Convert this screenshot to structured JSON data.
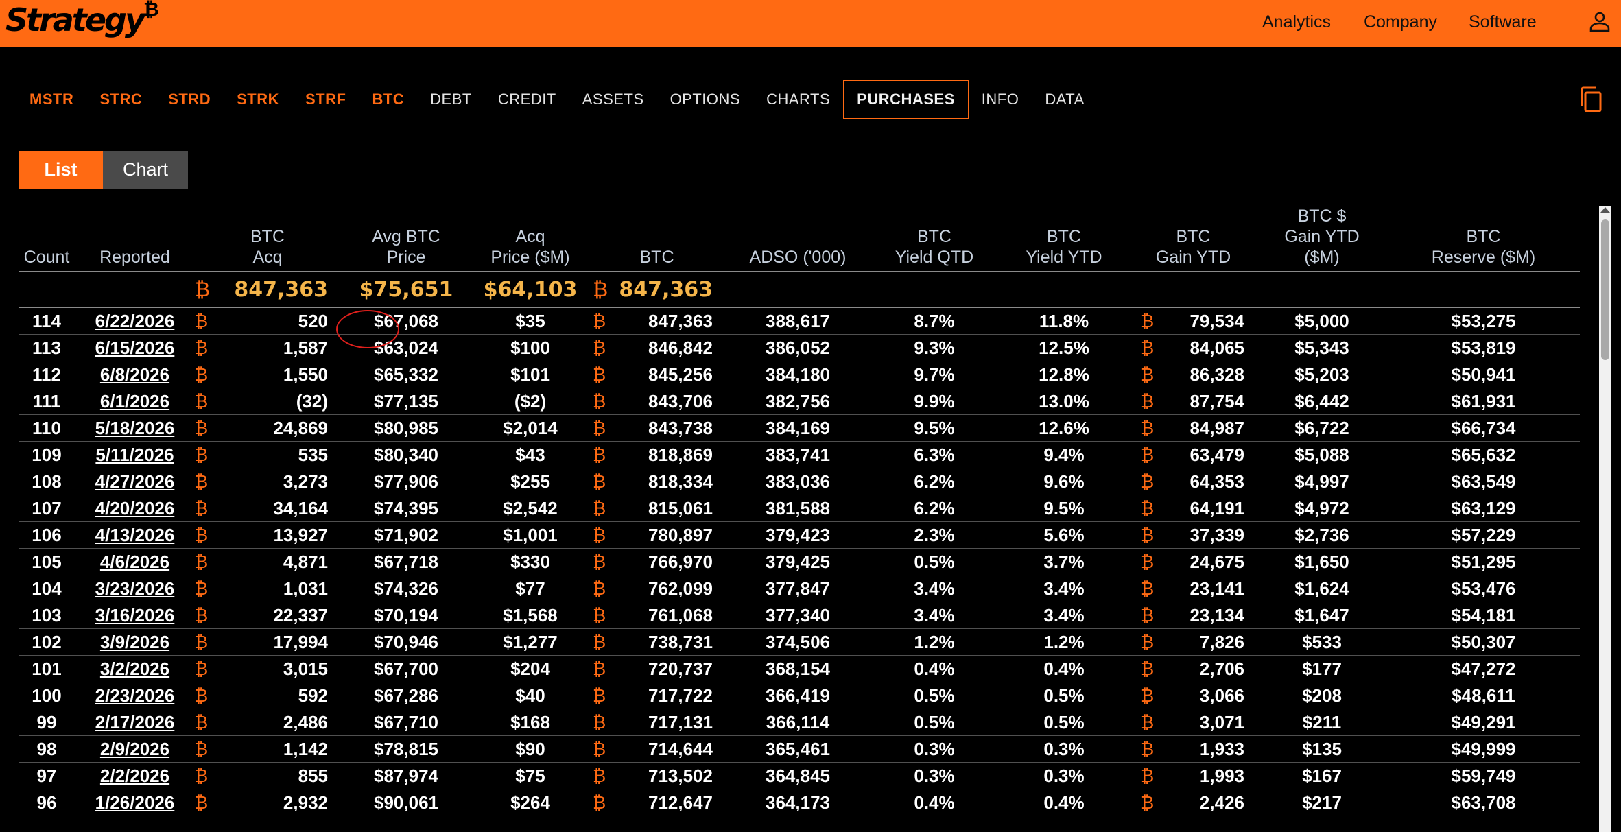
{
  "brand": {
    "name": "Strategy",
    "mark": "₿"
  },
  "top_nav": [
    "Analytics",
    "Company",
    "Software"
  ],
  "ticker_nav": [
    {
      "label": "MSTR",
      "style": "orange"
    },
    {
      "label": "STRC",
      "style": "orange"
    },
    {
      "label": "STRD",
      "style": "orange"
    },
    {
      "label": "STRK",
      "style": "orange"
    },
    {
      "label": "STRF",
      "style": "orange"
    },
    {
      "label": "BTC",
      "style": "orange"
    },
    {
      "label": "DEBT",
      "style": "plain"
    },
    {
      "label": "CREDIT",
      "style": "plain"
    },
    {
      "label": "ASSETS",
      "style": "plain"
    },
    {
      "label": "OPTIONS",
      "style": "plain"
    },
    {
      "label": "CHARTS",
      "style": "plain"
    },
    {
      "label": "PURCHASES",
      "style": "active"
    },
    {
      "label": "INFO",
      "style": "plain"
    },
    {
      "label": "DATA",
      "style": "plain"
    }
  ],
  "toggle": {
    "list": "List",
    "chart": "Chart"
  },
  "btc_symbol": "₿",
  "columns": [
    [
      "Count"
    ],
    [
      "Reported"
    ],
    [
      "BTC",
      "Acq"
    ],
    [
      "Avg BTC",
      "Price"
    ],
    [
      "Acq",
      "Price ($M)"
    ],
    [
      "BTC"
    ],
    [
      "ADSO ('000)"
    ],
    [
      "BTC",
      "Yield QTD"
    ],
    [
      "BTC",
      "Yield YTD"
    ],
    [
      "BTC",
      "Gain YTD"
    ],
    [
      "BTC $",
      "Gain YTD",
      "($M)"
    ],
    [
      "BTC",
      "Reserve ($M)"
    ]
  ],
  "summary": {
    "btc_acq": "847,363",
    "avg_price": "$75,651",
    "acq_price": "$64,103",
    "btc": "847,363"
  },
  "rows": [
    [
      "114",
      "6/22/2026",
      "520",
      "$67,068",
      "$35",
      "847,363",
      "388,617",
      "8.7%",
      "11.8%",
      "79,534",
      "$5,000",
      "$53,275"
    ],
    [
      "113",
      "6/15/2026",
      "1,587",
      "$63,024",
      "$100",
      "846,842",
      "386,052",
      "9.3%",
      "12.5%",
      "84,065",
      "$5,343",
      "$53,819"
    ],
    [
      "112",
      "6/8/2026",
      "1,550",
      "$65,332",
      "$101",
      "845,256",
      "384,180",
      "9.7%",
      "12.8%",
      "86,328",
      "$5,203",
      "$50,941"
    ],
    [
      "111",
      "6/1/2026",
      "(32)",
      "$77,135",
      "($2)",
      "843,706",
      "382,756",
      "9.9%",
      "13.0%",
      "87,754",
      "$6,442",
      "$61,931"
    ],
    [
      "110",
      "5/18/2026",
      "24,869",
      "$80,985",
      "$2,014",
      "843,738",
      "384,169",
      "9.5%",
      "12.6%",
      "84,987",
      "$6,722",
      "$66,734"
    ],
    [
      "109",
      "5/11/2026",
      "535",
      "$80,340",
      "$43",
      "818,869",
      "383,741",
      "6.3%",
      "9.4%",
      "63,479",
      "$5,088",
      "$65,632"
    ],
    [
      "108",
      "4/27/2026",
      "3,273",
      "$77,906",
      "$255",
      "818,334",
      "383,036",
      "6.2%",
      "9.6%",
      "64,353",
      "$4,997",
      "$63,549"
    ],
    [
      "107",
      "4/20/2026",
      "34,164",
      "$74,395",
      "$2,542",
      "815,061",
      "381,588",
      "6.2%",
      "9.5%",
      "64,191",
      "$4,972",
      "$63,129"
    ],
    [
      "106",
      "4/13/2026",
      "13,927",
      "$71,902",
      "$1,001",
      "780,897",
      "379,423",
      "2.3%",
      "5.6%",
      "37,339",
      "$2,736",
      "$57,229"
    ],
    [
      "105",
      "4/6/2026",
      "4,871",
      "$67,718",
      "$330",
      "766,970",
      "379,425",
      "0.5%",
      "3.7%",
      "24,675",
      "$1,650",
      "$51,295"
    ],
    [
      "104",
      "3/23/2026",
      "1,031",
      "$74,326",
      "$77",
      "762,099",
      "377,847",
      "3.4%",
      "3.4%",
      "23,141",
      "$1,624",
      "$53,476"
    ],
    [
      "103",
      "3/16/2026",
      "22,337",
      "$70,194",
      "$1,568",
      "761,068",
      "377,340",
      "3.4%",
      "3.4%",
      "23,134",
      "$1,647",
      "$54,181"
    ],
    [
      "102",
      "3/9/2026",
      "17,994",
      "$70,946",
      "$1,277",
      "738,731",
      "374,506",
      "1.2%",
      "1.2%",
      "7,826",
      "$533",
      "$50,307"
    ],
    [
      "101",
      "3/2/2026",
      "3,015",
      "$67,700",
      "$204",
      "720,737",
      "368,154",
      "0.4%",
      "0.4%",
      "2,706",
      "$177",
      "$47,272"
    ],
    [
      "100",
      "2/23/2026",
      "592",
      "$67,286",
      "$40",
      "717,722",
      "366,419",
      "0.5%",
      "0.5%",
      "3,066",
      "$208",
      "$48,611"
    ],
    [
      "99",
      "2/17/2026",
      "2,486",
      "$67,710",
      "$168",
      "717,131",
      "366,114",
      "0.5%",
      "0.5%",
      "3,071",
      "$211",
      "$49,291"
    ],
    [
      "98",
      "2/9/2026",
      "1,142",
      "$78,815",
      "$90",
      "714,644",
      "365,461",
      "0.3%",
      "0.3%",
      "1,933",
      "$135",
      "$49,999"
    ],
    [
      "97",
      "2/2/2026",
      "855",
      "$87,974",
      "$75",
      "713,502",
      "364,845",
      "0.3%",
      "0.3%",
      "1,993",
      "$167",
      "$59,749"
    ],
    [
      "96",
      "1/26/2026",
      "2,932",
      "$90,061",
      "$264",
      "712,647",
      "364,173",
      "0.4%",
      "0.4%",
      "2,426",
      "$217",
      "$63,708"
    ]
  ],
  "colors": {
    "accent": "#ff6a13",
    "summary": "#f5b54a",
    "header_text": "#c7d1de",
    "annotation": "#e0201c"
  },
  "icons": [
    "user-icon",
    "copy-icon",
    "bitcoin-icon"
  ]
}
